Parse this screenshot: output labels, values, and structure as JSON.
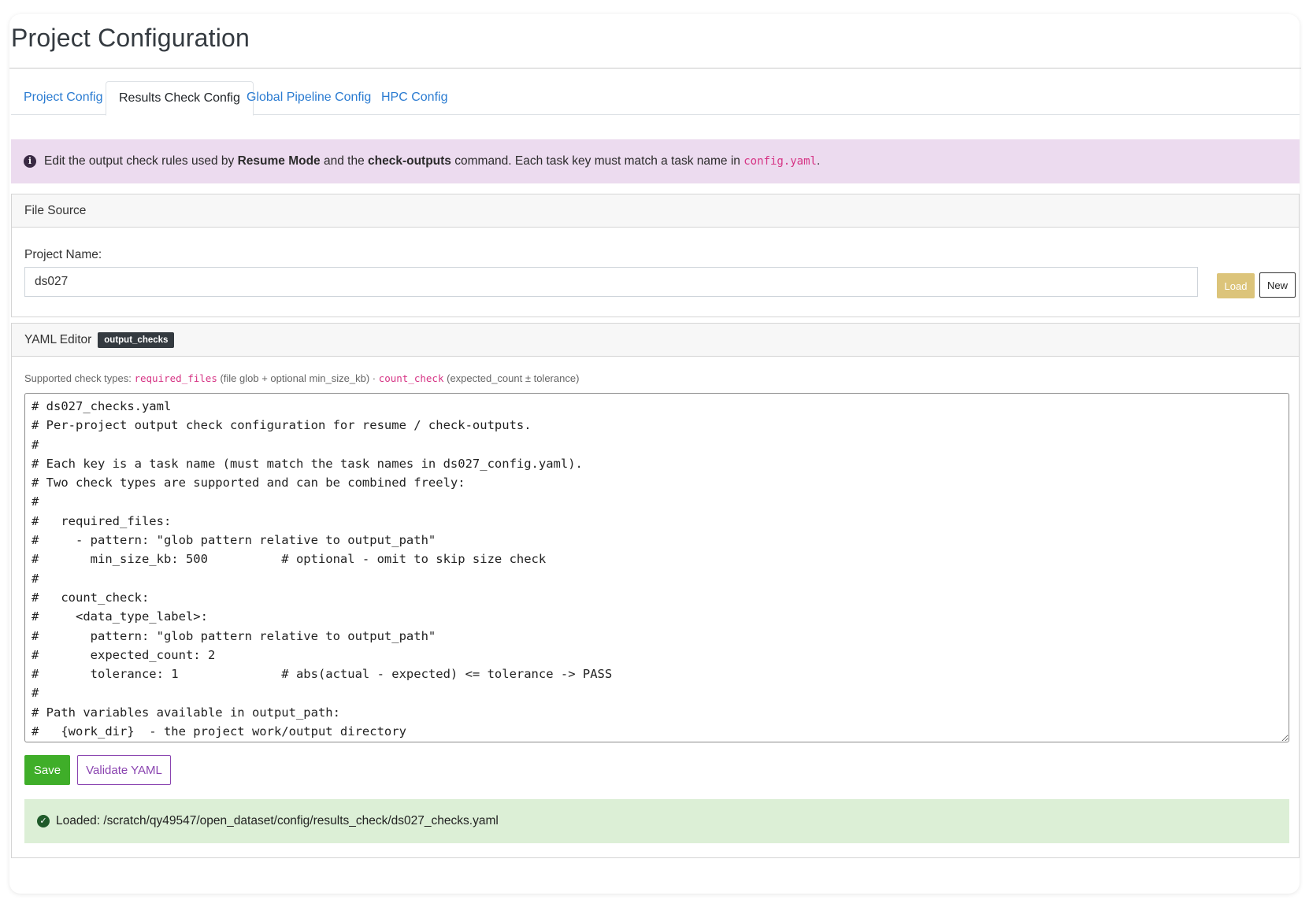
{
  "page": {
    "title": "Project Configuration"
  },
  "tabs": [
    {
      "label": "Project Config"
    },
    {
      "label": "Results Check Config"
    },
    {
      "label": "Global Pipeline Config"
    },
    {
      "label": "HPC Config"
    }
  ],
  "info_alert": {
    "t1": "Edit the output check rules used by ",
    "b1": "Resume Mode",
    "t2": " and the ",
    "b2": "check-outputs",
    "t3": " command. Each task key must match a task name in ",
    "code": "config.yaml",
    "t4": "."
  },
  "file_source": {
    "header": "File Source",
    "label": "Project Name:",
    "value": "ds027",
    "load_label": "Load",
    "new_label": "New"
  },
  "yaml_editor": {
    "header": "YAML Editor",
    "badge": "output_checks",
    "supported": {
      "prefix": "Supported check types: ",
      "type1": "required_files",
      "desc1": " (file glob + optional min_size_kb) · ",
      "type2": "count_check",
      "desc2": " (expected_count ± tolerance)"
    },
    "content": "# ds027_checks.yaml\n# Per-project output check configuration for resume / check-outputs.\n#\n# Each key is a task name (must match the task names in ds027_config.yaml).\n# Two check types are supported and can be combined freely:\n#\n#   required_files:\n#     - pattern: \"glob pattern relative to output_path\"\n#       min_size_kb: 500          # optional - omit to skip size check\n#\n#   count_check:\n#     <data_type_label>:\n#       pattern: \"glob pattern relative to output_path\"\n#       expected_count: 2\n#       tolerance: 1              # abs(actual - expected) <= tolerance -> PASS\n#\n# Path variables available in output_path:\n#   {work_dir}  - the project work/output directory",
    "save_label": "Save",
    "validate_label": "Validate YAML"
  },
  "status": {
    "text": "Loaded: /scratch/qy49547/open_dataset/config/results_check/ds027_checks.yaml"
  },
  "colors": {
    "info_bg": "#ecdbef",
    "success_bg": "#dcefd6",
    "save_btn": "#3fae29",
    "load_btn": "#dcc47a",
    "validate_btn": "#8a44b0",
    "link": "#2a7bd1",
    "code": "#d63384"
  }
}
